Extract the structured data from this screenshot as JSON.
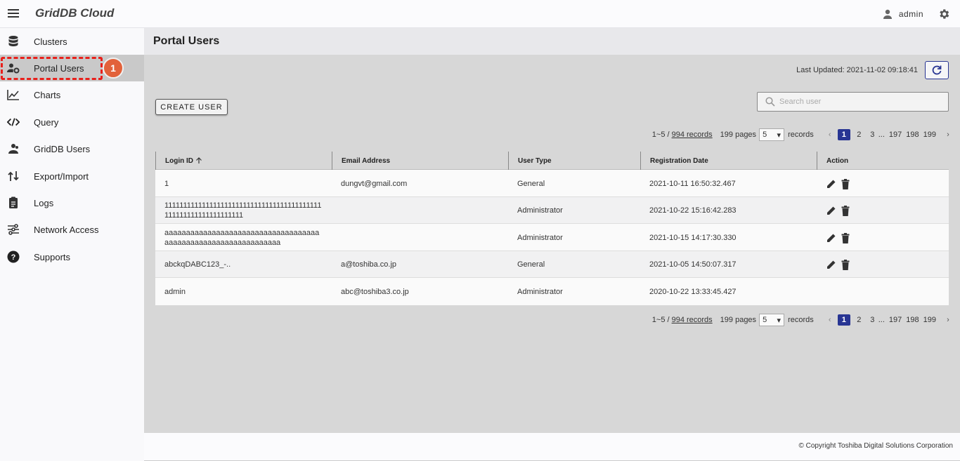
{
  "app": {
    "title": "GridDB Cloud",
    "user": "admin"
  },
  "sidebar": {
    "items": [
      {
        "label": "Clusters",
        "icon": "database-icon"
      },
      {
        "label": "Portal Users",
        "icon": "user-gear-icon"
      },
      {
        "label": "Charts",
        "icon": "chart-line-icon"
      },
      {
        "label": "Query",
        "icon": "code-icon"
      },
      {
        "label": "GridDB Users",
        "icon": "users-icon"
      },
      {
        "label": "Export/Import",
        "icon": "export-import-icon"
      },
      {
        "label": "Logs",
        "icon": "clipboard-icon"
      },
      {
        "label": "Network Access",
        "icon": "network-icon"
      },
      {
        "label": "Supports",
        "icon": "help-icon"
      }
    ],
    "active_index": 1,
    "annotation_badge": "1"
  },
  "page": {
    "title": "Portal Users",
    "last_updated": "Last Updated: 2021-11-02 09:18:41",
    "create_button": "CREATE USER",
    "search_placeholder": "Search user"
  },
  "pagination": {
    "range": "1~5 /",
    "records_link": "994 records",
    "pages": "199 pages",
    "per_page": "5",
    "records_label": "records",
    "page_numbers": [
      "1",
      "2",
      "3"
    ],
    "dots": "...",
    "last_pages": [
      "197",
      "198",
      "199"
    ],
    "current": "1"
  },
  "table": {
    "columns": [
      "Login ID",
      "Email Address",
      "User Type",
      "Registration Date",
      "Action"
    ],
    "rows": [
      {
        "login_id": "1",
        "email": "dungvt@gmail.com",
        "user_type": "General",
        "registration_date": "2021-10-11 16:50:32.467",
        "actions": true
      },
      {
        "login_id": "111111111111111111111111111111111111111111111111111111111111111",
        "email": "",
        "user_type": "Administrator",
        "registration_date": "2021-10-22 15:16:42.283",
        "actions": true
      },
      {
        "login_id": "aaaaaaaaaaaaaaaaaaaaaaaaaaaaaaaaaaaaaaaaaaaaaaaaaaaaaaaaaaaaaaa",
        "email": "",
        "user_type": "Administrator",
        "registration_date": "2021-10-15 14:17:30.330",
        "actions": true
      },
      {
        "login_id": "abckqDABC123_-..",
        "email": "a@toshiba.co.jp",
        "user_type": "General",
        "registration_date": "2021-10-05 14:50:07.317",
        "actions": true
      },
      {
        "login_id": "admin",
        "email": "abc@toshiba3.co.jp",
        "user_type": "Administrator",
        "registration_date": "2020-10-22 13:33:45.427",
        "actions": false
      }
    ]
  },
  "footer": {
    "copyright": "© Copyright Toshiba Digital Solutions Corporation"
  },
  "colors": {
    "accent": "#283593",
    "badge": "#e2623b",
    "highlight": "#e8201b"
  }
}
